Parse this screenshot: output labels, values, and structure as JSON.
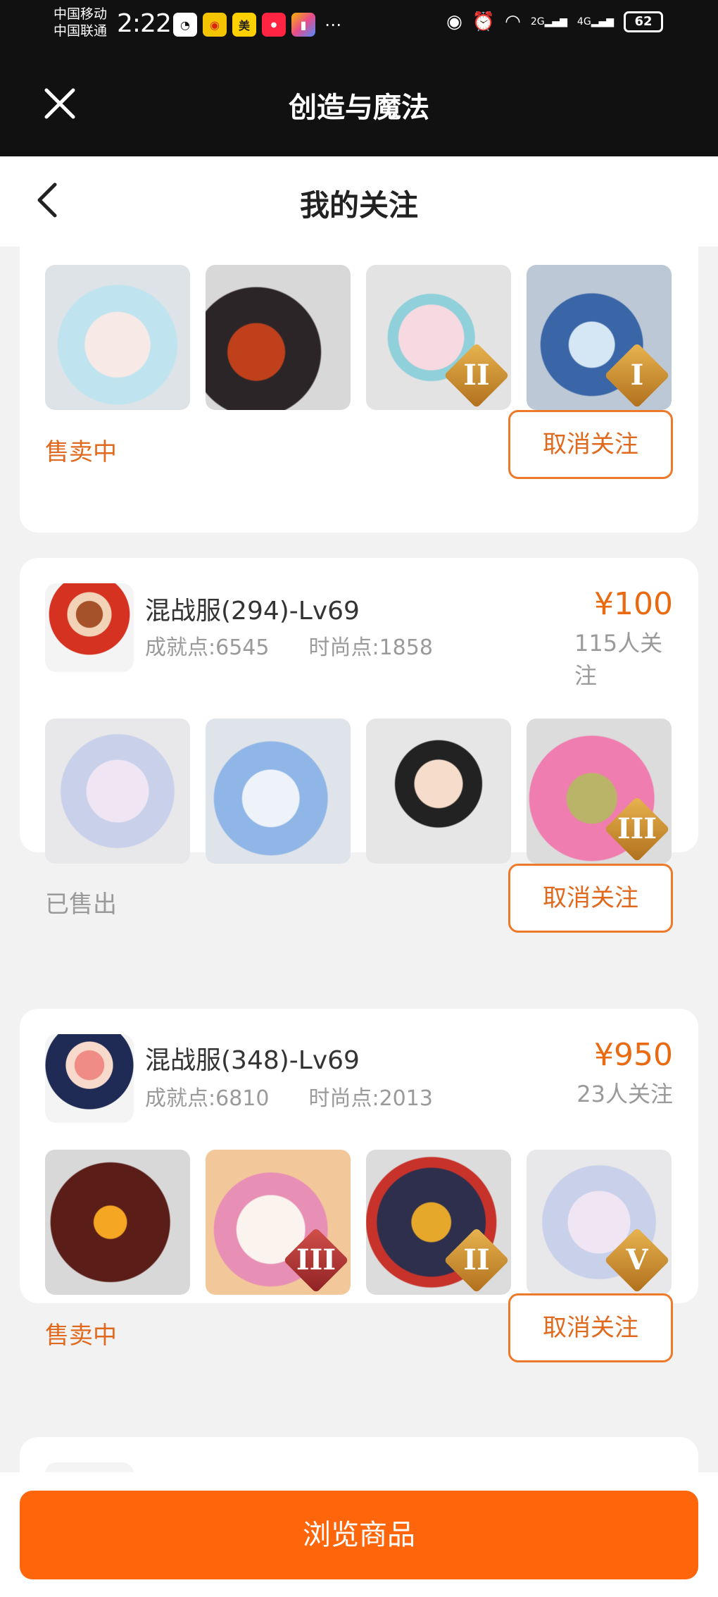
{
  "status_bar": {
    "carrier1": "中国移动",
    "carrier2": "中国联通",
    "time": "2:22",
    "network1": "2G",
    "network2": "4G",
    "battery": "62"
  },
  "app": {
    "title": "创造与魔法"
  },
  "nav": {
    "title": "我的关注"
  },
  "cards": [
    {
      "status": "售卖中",
      "button": "取消关注",
      "thumbs": [
        {
          "icon": "cloud-girl-pet",
          "tier": ""
        },
        {
          "icon": "black-goat-mount",
          "tier": ""
        },
        {
          "icon": "pink-rabbit-pet",
          "tier": "II"
        },
        {
          "icon": "blue-tiger-mount",
          "tier": "I"
        }
      ]
    },
    {
      "server": "混战服(294)-Lv69",
      "achievement": "成就点:6545",
      "fashion": "时尚点:1858",
      "price": "¥100",
      "followers": "115人关注",
      "status": "已售出",
      "button": "取消关注",
      "thumbs": [
        {
          "icon": "white-spirit-pet",
          "tier": ""
        },
        {
          "icon": "ghost-horse-mount",
          "tier": ""
        },
        {
          "icon": "court-lady-pet",
          "tier": ""
        },
        {
          "icon": "pink-bear-pet",
          "tier": "III"
        }
      ]
    },
    {
      "server": "混战服(348)-Lv69",
      "achievement": "成就点:6810",
      "fashion": "时尚点:2013",
      "price": "¥950",
      "followers": "23人关注",
      "status": "售卖中",
      "button": "取消关注",
      "thumbs": [
        {
          "icon": "fire-dragon-mount",
          "tier": ""
        },
        {
          "icon": "white-unicorn-mount",
          "tier": "III"
        },
        {
          "icon": "gold-dragon-mount",
          "tier": "II"
        },
        {
          "icon": "white-spirit-pet",
          "tier": "V"
        }
      ]
    }
  ],
  "bottom": {
    "button": "浏览商品"
  },
  "colors": {
    "accent": "#ff650b",
    "price": "#ea6a12",
    "header_bg": "#111111"
  }
}
